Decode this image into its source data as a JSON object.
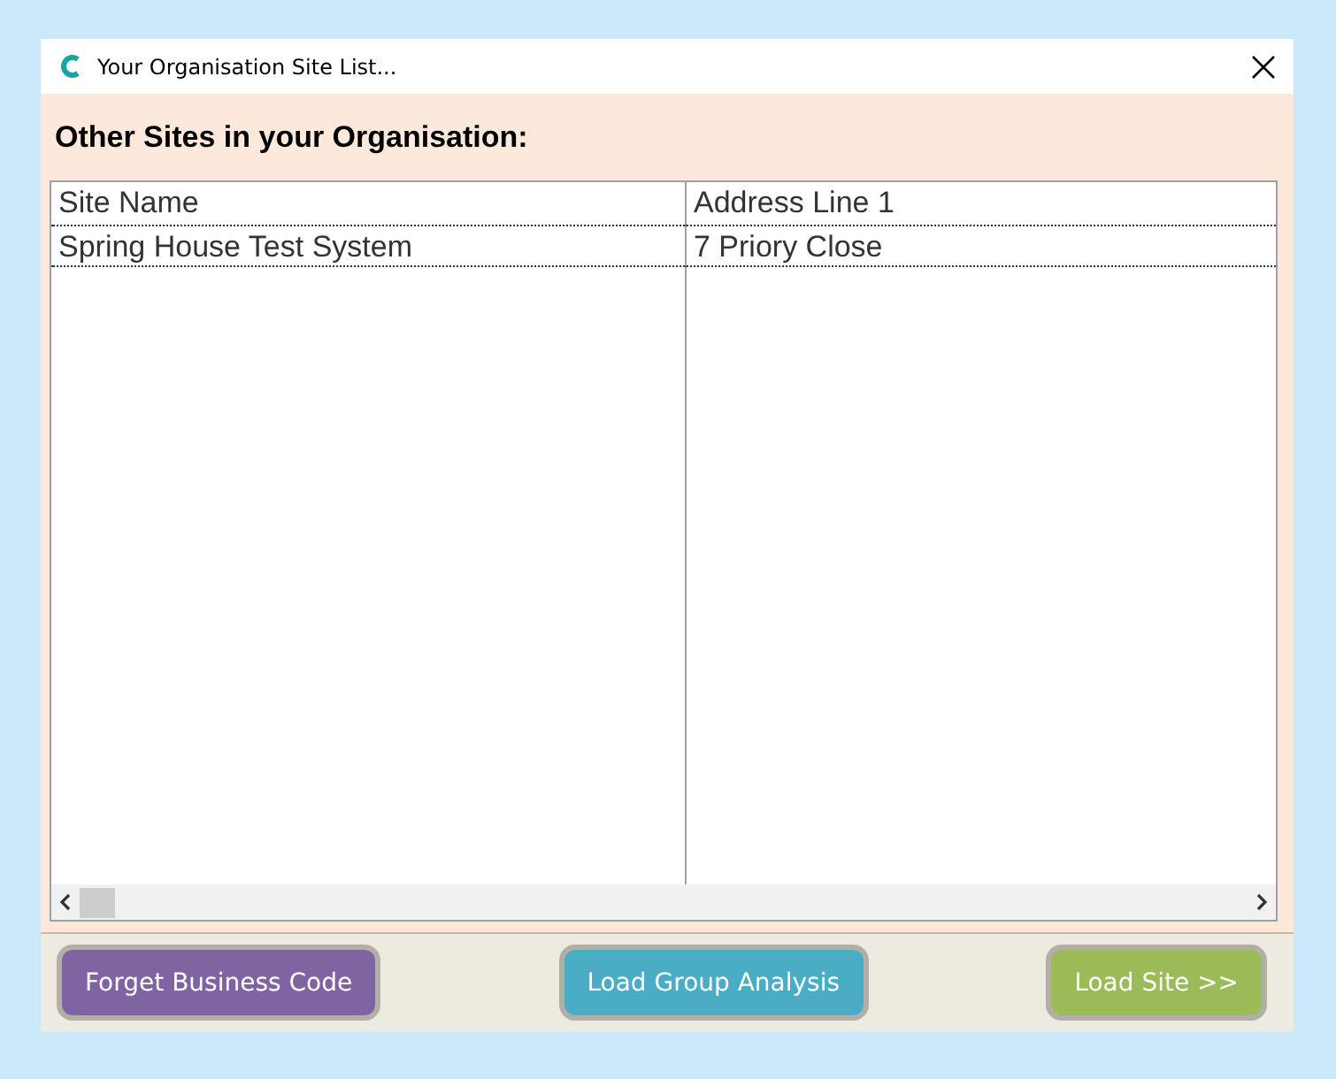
{
  "window": {
    "title": "Your Organisation Site List..."
  },
  "heading": "Other Sites in your Organisation:",
  "table": {
    "columns": [
      "Site Name",
      "Address Line 1"
    ],
    "rows": [
      {
        "cells": [
          "Spring House Test System",
          "7 Priory Close"
        ],
        "focused": true
      }
    ]
  },
  "buttons": [
    {
      "label": "Forget Business Code",
      "color": "#8064a2"
    },
    {
      "label": "Load Group Analysis",
      "color": "#4bacc6"
    },
    {
      "label": "Load Site >>",
      "color": "#9bbb59"
    }
  ]
}
